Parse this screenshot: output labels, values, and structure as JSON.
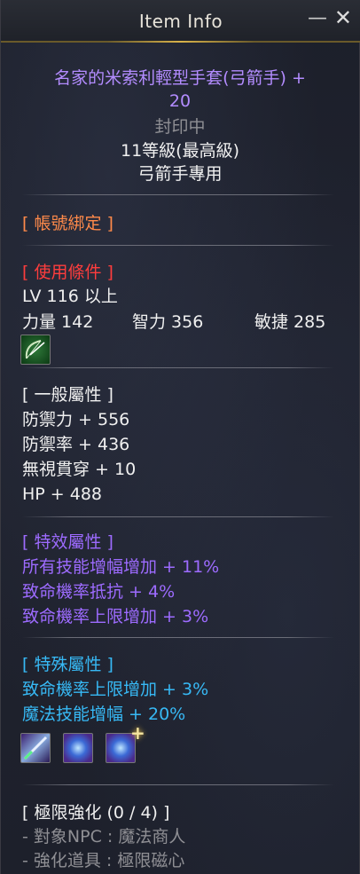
{
  "window": {
    "title": "Item Info",
    "minimize_label": "—",
    "close_label": "✕"
  },
  "item": {
    "name_line1": "名家的米索利輕型手套(弓箭手) +",
    "name_line2": "20",
    "sealed": "封印中",
    "grade": "11等級(最高級)",
    "class_only": "弓箭手專用"
  },
  "binding": {
    "label": "[ 帳號綁定 ]"
  },
  "requirements": {
    "header": "[ 使用條件 ]",
    "level": "LV 116 以上",
    "str": "力量 142",
    "int": "智力 356",
    "dex": "敏捷 285",
    "icon": "bow-icon"
  },
  "general": {
    "header": "[ 一般屬性 ]",
    "stats": [
      "防禦力  + 556",
      "防禦率  + 436",
      "無視貫穿  + 10",
      "HP  + 488"
    ]
  },
  "special_effects": {
    "header": "[ 特效屬性 ]",
    "stats": [
      "所有技能增幅增加  + 11%",
      "致命機率抵抗  + 4%",
      "致命機率上限增加  + 3%"
    ]
  },
  "special_attrs": {
    "header": "[ 特殊屬性 ]",
    "stats": [
      "致命機率上限增加  + 3%",
      "魔法技能增幅  + 20%"
    ],
    "icons": [
      "sword-skill-icon",
      "magic-hands-icon",
      "magic-hands-icon"
    ],
    "plus_badge": "+"
  },
  "limit_enhance": {
    "header": "[ 極限強化 (0 / 4) ]",
    "lines": [
      "- 對象NPC : 魔法商人",
      "- 強化道具 : 極限磁心"
    ]
  }
}
